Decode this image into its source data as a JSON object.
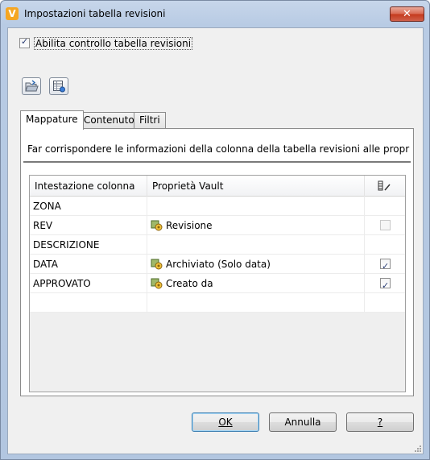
{
  "window": {
    "title": "Impostazioni tabella revisioni",
    "app_icon_letter": "V",
    "close_glyph": "✕"
  },
  "enable": {
    "label": "Abilita controllo tabella revisioni",
    "checked": true
  },
  "toolbar": {
    "items": [
      {
        "name": "open-folder-icon"
      },
      {
        "name": "table-properties-icon"
      }
    ]
  },
  "tabs": [
    {
      "label": "Mappature",
      "active": true
    },
    {
      "label": "Contenuto",
      "active": false
    },
    {
      "label": "Filtri",
      "active": false
    }
  ],
  "panel": {
    "description": "Far corrispondere le informazioni della colonna della tabella revisioni alle proprietà del vau"
  },
  "grid": {
    "headers": [
      "Intestazione colonna",
      "Proprietà Vault",
      "edit-column-icon"
    ],
    "rows": [
      {
        "column": "ZONA",
        "property": "",
        "has_icon": false,
        "checkbox": "none"
      },
      {
        "column": "REV",
        "property": "Revisione",
        "has_icon": true,
        "checkbox": "unchecked-disabled"
      },
      {
        "column": "DESCRIZIONE",
        "property": "",
        "has_icon": false,
        "checkbox": "none"
      },
      {
        "column": "DATA",
        "property": "Archiviato (Solo data)",
        "has_icon": true,
        "checkbox": "checked"
      },
      {
        "column": "APPROVATO",
        "property": "Creato da",
        "has_icon": true,
        "checkbox": "checked"
      },
      {
        "column": "",
        "property": "",
        "has_icon": false,
        "checkbox": "none"
      }
    ]
  },
  "buttons": {
    "ok": "OK",
    "cancel": "Annulla",
    "help": "?"
  }
}
